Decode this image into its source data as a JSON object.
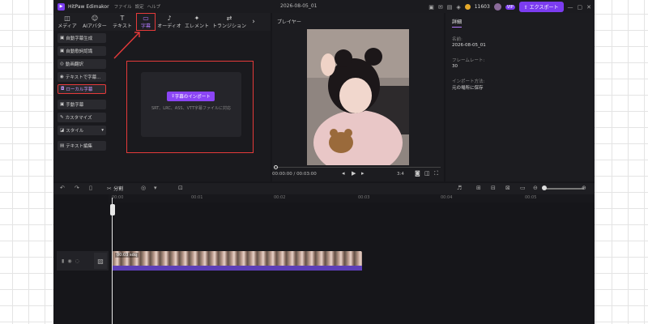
{
  "app": {
    "name": "HitPaw Edimakor",
    "menu": [
      "ファイル",
      "設定",
      "ヘルプ"
    ],
    "document_title": "2026-08-05_01",
    "coins": "11603",
    "vip": "VIP",
    "export_label": "エクスポート"
  },
  "toolbar": {
    "tabs": [
      {
        "label": "メディア",
        "icon": "media-icon"
      },
      {
        "label": "AIアバター",
        "icon": "avatar-icon"
      },
      {
        "label": "テキスト",
        "icon": "text-icon"
      },
      {
        "label": "字幕",
        "icon": "subtitle-icon",
        "active": true
      },
      {
        "label": "オーディオ",
        "icon": "audio-icon"
      },
      {
        "label": "エレメント",
        "icon": "element-icon"
      },
      {
        "label": "トランジション",
        "icon": "transition-icon"
      }
    ]
  },
  "sidebar": {
    "items": [
      {
        "label": "自動字幕生成"
      },
      {
        "label": "自動歌詞認識"
      },
      {
        "label": "動画翻訳"
      },
      {
        "label": "テキストで字幕..."
      },
      {
        "label": "ローカル字幕",
        "active": true
      },
      {
        "label": "手動字幕"
      },
      {
        "label": "カスタマイズ"
      },
      {
        "label": "スタイル"
      },
      {
        "label": "テキスト編集"
      }
    ]
  },
  "import": {
    "button_label": "字幕のインポート",
    "formats_text": "SRT、LRC、ASS、VTT字幕ファイルに対応"
  },
  "player": {
    "title": "プレイヤー",
    "time_current": "00:00:00",
    "time_total": "00:03:00",
    "ratio": "3:4"
  },
  "detail": {
    "tab": "詳細",
    "name_label": "名前:",
    "name_value": "2026-08-05_01",
    "framerate_label": "フレームレート:",
    "framerate_value": "30",
    "import_label": "インポート方法:",
    "import_value": "元の場所に保存"
  },
  "timeline": {
    "split_label": "分割",
    "ticks": [
      "00:00",
      "00:01",
      "00:02",
      "00:03",
      "00:04",
      "00:05"
    ],
    "clip_label": "00:03 sdq"
  },
  "colors": {
    "accent": "#8b45f5",
    "highlight": "#e53a3a",
    "background": "#16161a"
  }
}
